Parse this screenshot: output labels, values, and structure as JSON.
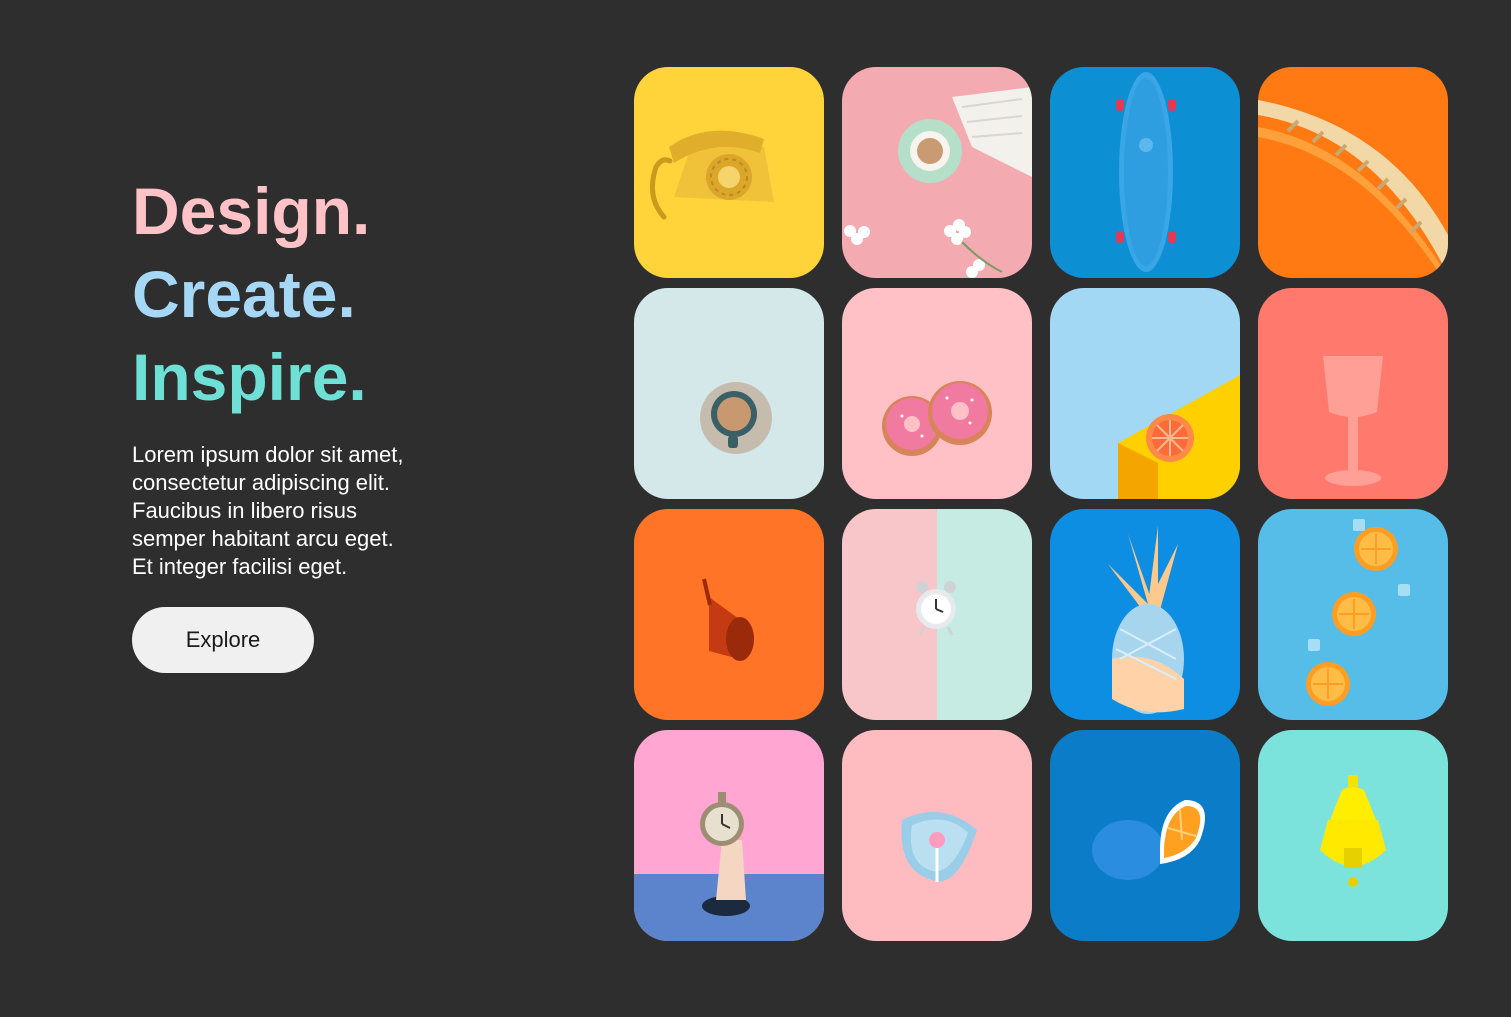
{
  "hero": {
    "headline": [
      {
        "text": "Design.",
        "color": "#ffc2c7"
      },
      {
        "text": "Create.",
        "color": "#a6d8f5"
      },
      {
        "text": "Inspire.",
        "color": "#6ee0d6"
      }
    ],
    "lead_lines": [
      "Lorem ipsum dolor sit amet,",
      "consectetur adipiscing elit.",
      "Faucibus in libero risus",
      "semper habitant arcu eget.",
      "Et integer facilisi eget."
    ],
    "cta_label": "Explore"
  },
  "gallery": {
    "tiles": [
      {
        "icon": "telephone-icon",
        "bg": "#ffd43a"
      },
      {
        "icon": "coffee-cup-icon",
        "bg": "#f3aab0"
      },
      {
        "icon": "skateboard-icon",
        "bg": "#0d8fd3"
      },
      {
        "icon": "stairs-icon",
        "bg": "#ff7a12"
      },
      {
        "icon": "coffee-cup-icon",
        "bg": "#d4e7e9"
      },
      {
        "icon": "donut-icon",
        "bg": "#ffc1c6"
      },
      {
        "icon": "grapefruit-icon",
        "bg": "#a3d8f4"
      },
      {
        "icon": "wine-glass-icon",
        "bg": "#ff7a6c"
      },
      {
        "icon": "megaphone-icon",
        "bg": "#ff7426"
      },
      {
        "icon": "alarm-clock-icon",
        "bg": "#f8c6c8"
      },
      {
        "icon": "pineapple-icon",
        "bg": "#0d8ee2"
      },
      {
        "icon": "orange-slices-icon",
        "bg": "#56bde8"
      },
      {
        "icon": "pocket-watch-icon",
        "bg": "#ffa6d2"
      },
      {
        "icon": "lollipop-icon",
        "bg": "#ffbcc0"
      },
      {
        "icon": "orange-icon",
        "bg": "#0b7dc8"
      },
      {
        "icon": "teapot-icon",
        "bg": "#7ce3dc"
      }
    ]
  }
}
